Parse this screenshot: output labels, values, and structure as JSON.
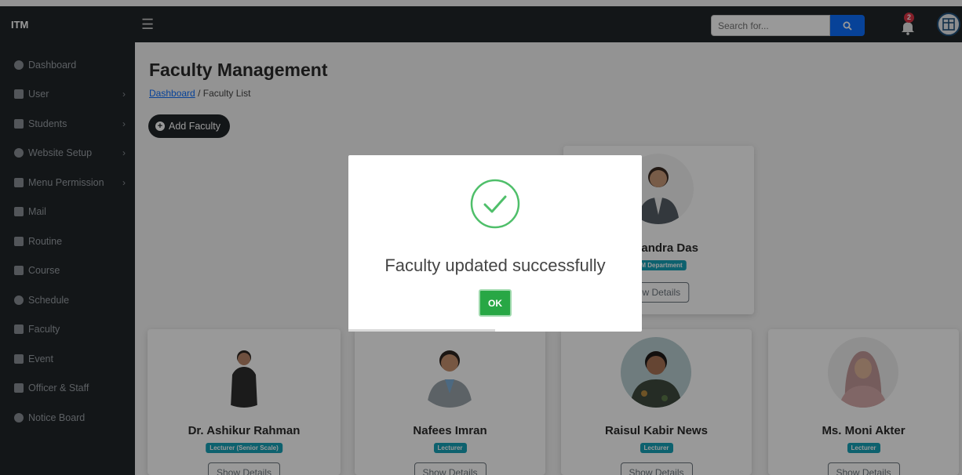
{
  "app": {
    "brand": "ITM"
  },
  "search": {
    "placeholder": "Search for..."
  },
  "notifications": {
    "count": "2"
  },
  "sidebar": {
    "items": [
      {
        "label": "Dashboard",
        "icon": "dashboard-icon",
        "chevron": false
      },
      {
        "label": "User",
        "icon": "users-icon",
        "chevron": true
      },
      {
        "label": "Students",
        "icon": "students-icon",
        "chevron": true
      },
      {
        "label": "Website Setup",
        "icon": "settings-icon",
        "chevron": true
      },
      {
        "label": "Menu Permission",
        "icon": "lock-icon",
        "chevron": true
      },
      {
        "label": "Mail",
        "icon": "mail-icon",
        "chevron": false
      },
      {
        "label": "Routine",
        "icon": "table-icon",
        "chevron": false
      },
      {
        "label": "Course",
        "icon": "book-icon",
        "chevron": false
      },
      {
        "label": "Schedule",
        "icon": "clock-icon",
        "chevron": false
      },
      {
        "label": "Faculty",
        "icon": "faculty-icon",
        "chevron": false
      },
      {
        "label": "Event",
        "icon": "calendar-icon",
        "chevron": false
      },
      {
        "label": "Officer & Staff",
        "icon": "staff-icon",
        "chevron": false
      },
      {
        "label": "Notice Board",
        "icon": "pin-icon",
        "chevron": false
      }
    ]
  },
  "page": {
    "title": "Faculty Management",
    "breadcrumb_link": "Dashboard",
    "breadcrumb_sep": "/",
    "breadcrumb_current": "Faculty List",
    "add_button": "Add Faculty"
  },
  "faculty": [
    {
      "name": "l Chandra Das",
      "role": "ITM Department",
      "details": "ow Details"
    },
    {
      "name": "Dr. Ashikur Rahman",
      "role": "Lecturer (Senior Scale)",
      "details": "Show Details"
    },
    {
      "name": "Nafees Imran",
      "role": "Lecturer",
      "details": "Show Details"
    },
    {
      "name": "Raisul Kabir News",
      "role": "Lecturer",
      "details": "Show Details"
    },
    {
      "name": "Ms. Moni Akter",
      "role": "Lecturer",
      "details": "Show Details"
    }
  ],
  "modal": {
    "title": "Faculty updated successfully",
    "ok_label": "OK",
    "icon": "success-check-icon",
    "timer_progress": 0.5
  },
  "colors": {
    "sidebar_bg": "#212529",
    "primary": "#0d6efd",
    "success": "#28a745",
    "badge": "#17a2b8",
    "danger": "#dc3545"
  }
}
